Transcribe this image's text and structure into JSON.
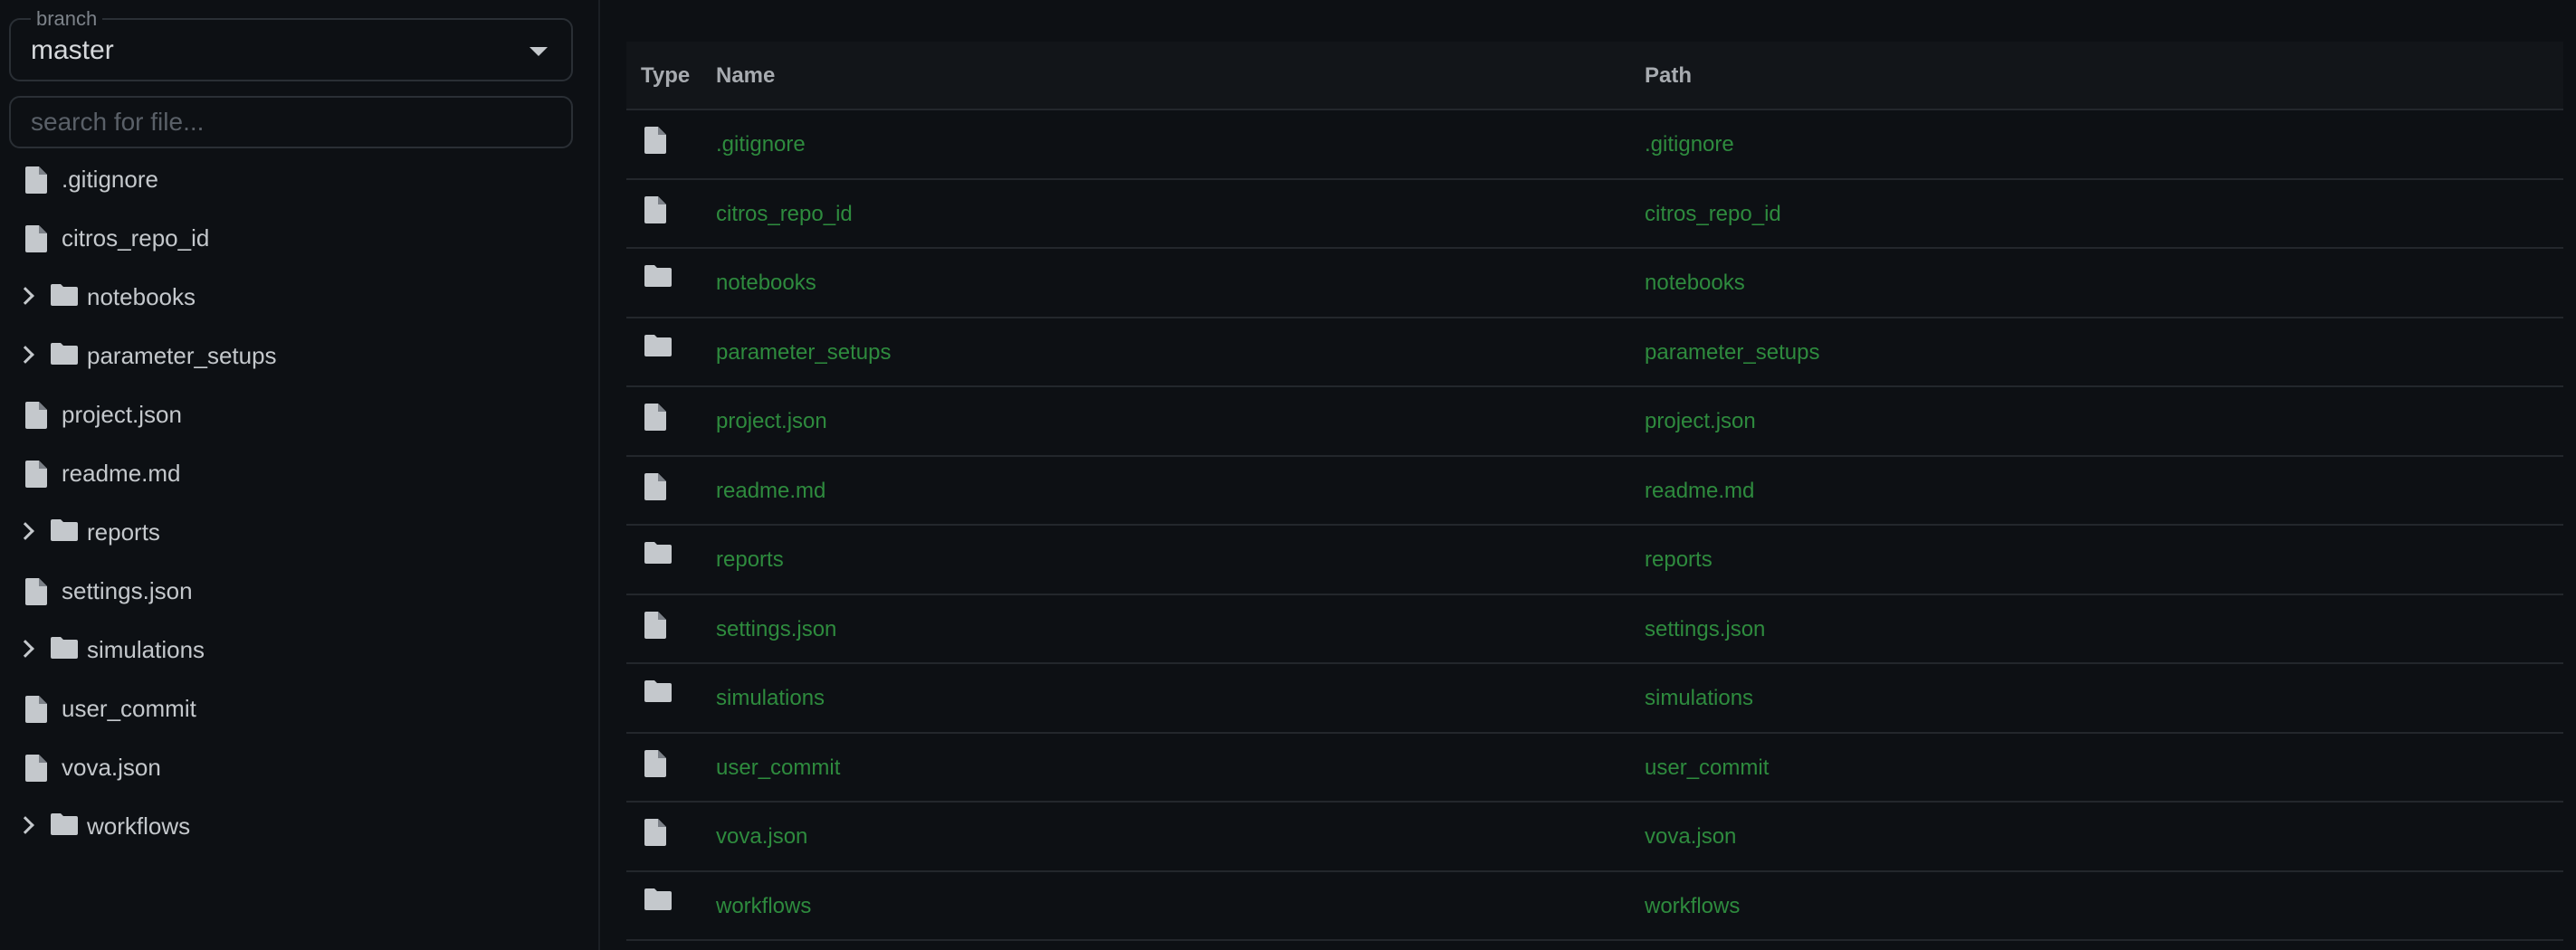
{
  "sidebar": {
    "branch_legend": "branch",
    "branch_value": "master",
    "search_placeholder": "search for file...",
    "items": [
      {
        "type": "file",
        "label": ".gitignore"
      },
      {
        "type": "file",
        "label": "citros_repo_id"
      },
      {
        "type": "folder",
        "label": "notebooks"
      },
      {
        "type": "folder",
        "label": "parameter_setups"
      },
      {
        "type": "file",
        "label": "project.json"
      },
      {
        "type": "file",
        "label": "readme.md"
      },
      {
        "type": "folder",
        "label": "reports"
      },
      {
        "type": "file",
        "label": "settings.json"
      },
      {
        "type": "folder",
        "label": "simulations"
      },
      {
        "type": "file",
        "label": "user_commit"
      },
      {
        "type": "file",
        "label": "vova.json"
      },
      {
        "type": "folder",
        "label": "workflows"
      }
    ]
  },
  "table": {
    "headers": {
      "type": "Type",
      "name": "Name",
      "path": "Path"
    },
    "rows": [
      {
        "type": "file",
        "name": ".gitignore",
        "path": ".gitignore"
      },
      {
        "type": "file",
        "name": "citros_repo_id",
        "path": "citros_repo_id"
      },
      {
        "type": "folder",
        "name": "notebooks",
        "path": "notebooks"
      },
      {
        "type": "folder",
        "name": "parameter_setups",
        "path": "parameter_setups"
      },
      {
        "type": "file",
        "name": "project.json",
        "path": "project.json"
      },
      {
        "type": "file",
        "name": "readme.md",
        "path": "readme.md"
      },
      {
        "type": "folder",
        "name": "reports",
        "path": "reports"
      },
      {
        "type": "file",
        "name": "settings.json",
        "path": "settings.json"
      },
      {
        "type": "folder",
        "name": "simulations",
        "path": "simulations"
      },
      {
        "type": "file",
        "name": "user_commit",
        "path": "user_commit"
      },
      {
        "type": "file",
        "name": "vova.json",
        "path": "vova.json"
      },
      {
        "type": "folder",
        "name": "workflows",
        "path": "workflows"
      }
    ]
  },
  "colors": {
    "background": "#0d1014",
    "link_green": "#2e8b3e",
    "text": "#c4c8cc",
    "border": "#23272c"
  },
  "icons": {
    "file": "file-icon",
    "folder": "folder-icon",
    "expand": "chevron-right-icon",
    "dropdown": "caret-down-icon"
  }
}
